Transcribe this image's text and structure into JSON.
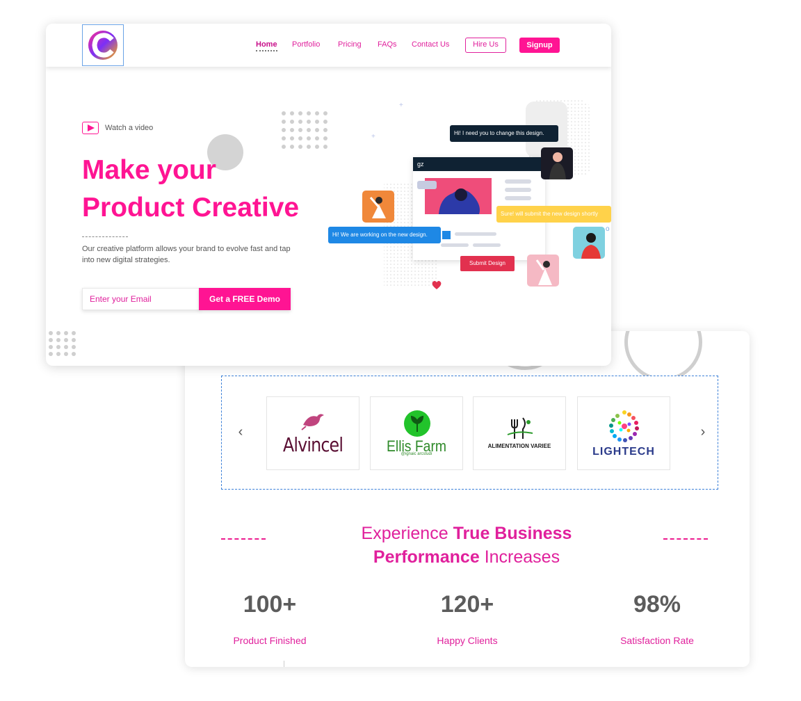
{
  "nav": {
    "links": [
      {
        "label": "Home",
        "active": true
      },
      {
        "label": "Portfolio",
        "active": false
      },
      {
        "label": "Pricing",
        "active": false
      },
      {
        "label": "FAQs",
        "active": false
      },
      {
        "label": "Contact Us",
        "active": false
      }
    ],
    "hire_label": "Hire Us",
    "signup_label": "Signup"
  },
  "hero": {
    "watch_label": "Watch a video",
    "title_line1": "Make your",
    "title_line2": "Product Creative",
    "description": "Our creative platform allows your brand to evolve fast and tap into new digital strategies.",
    "email_placeholder": "Enter your Email",
    "cta_label": "Get a FREE Demo"
  },
  "illustration": {
    "bubble_top": "Hi! I need you to change this design.",
    "window_title": "gz",
    "bubble_right": "Sure! will submit the new design shortly",
    "bubble_left": "Hi! We are working on the new design.",
    "submit_label": "Submit Design"
  },
  "partners": {
    "logos": [
      {
        "name": "Alvincel"
      },
      {
        "name": "Ellis Farm",
        "sub": "@ignaic arcstudi"
      },
      {
        "name": "ALIMENTATION VARIEE"
      },
      {
        "name": "LIGHTECH"
      }
    ]
  },
  "experience": {
    "line1_normal": "Experience",
    "line1_bold": "True Business",
    "line2_bold": "Performance",
    "line2_normal": "Increases"
  },
  "stats": [
    {
      "value": "100+",
      "label": "Product Finished"
    },
    {
      "value": "120+",
      "label": "Happy Clients"
    },
    {
      "value": "98%",
      "label": "Satisfaction Rate"
    }
  ],
  "colors": {
    "accent": "#ff1493",
    "accent_text": "#e0209c",
    "dark": "#0f2233"
  }
}
